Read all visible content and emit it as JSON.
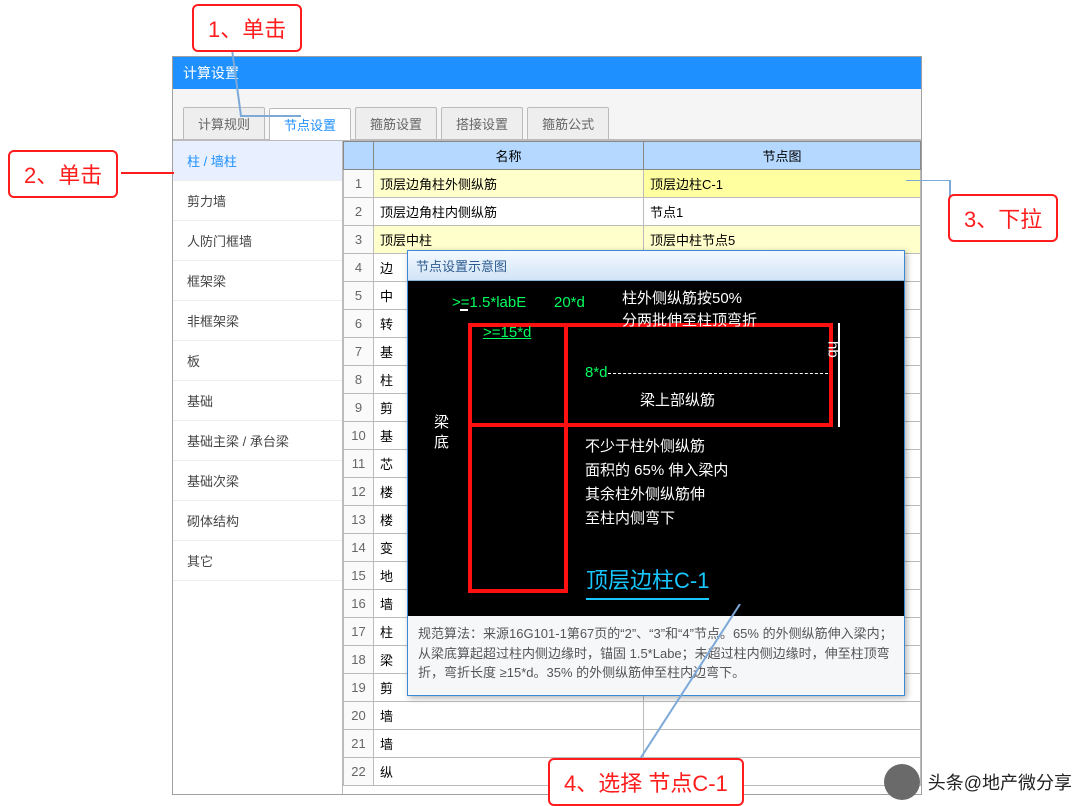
{
  "callouts": {
    "c1": "1、单击",
    "c2": "2、单击",
    "c3": "3、下拉",
    "c4": "4、选择 节点C-1"
  },
  "window": {
    "title": "计算设置"
  },
  "tabs": [
    "计算规则",
    "节点设置",
    "箍筋设置",
    "搭接设置",
    "箍筋公式"
  ],
  "active_tab": 1,
  "sidebar": [
    "柱 / 墙柱",
    "剪力墙",
    "人防门框墙",
    "框架梁",
    "非框架梁",
    "板",
    "基础",
    "基础主梁 / 承台梁",
    "基础次梁",
    "砌体结构",
    "其它"
  ],
  "active_side": 0,
  "columns": {
    "name": "名称",
    "node": "节点图"
  },
  "rows": [
    {
      "n": 1,
      "name": "顶层边角柱外侧纵筋",
      "node": "顶层边柱C-1",
      "hl": true,
      "sel": true
    },
    {
      "n": 2,
      "name": "顶层边角柱内侧纵筋",
      "node": "节点1"
    },
    {
      "n": 3,
      "name": "顶层中柱",
      "node": "顶层中柱节点5",
      "hl": true
    },
    {
      "n": 4,
      "name": "边",
      "node": ""
    },
    {
      "n": 5,
      "name": "中",
      "node": ""
    },
    {
      "n": 6,
      "name": "转",
      "node": ""
    },
    {
      "n": 7,
      "name": "基",
      "node": ""
    },
    {
      "n": 8,
      "name": "柱",
      "node": ""
    },
    {
      "n": 9,
      "name": "剪",
      "node": ""
    },
    {
      "n": 10,
      "name": "基",
      "node": ""
    },
    {
      "n": 11,
      "name": "芯",
      "node": ""
    },
    {
      "n": 12,
      "name": "楼",
      "node": ""
    },
    {
      "n": 13,
      "name": "楼",
      "node": ""
    },
    {
      "n": 14,
      "name": "变",
      "node": ""
    },
    {
      "n": 15,
      "name": "地",
      "node": ""
    },
    {
      "n": 16,
      "name": "墙",
      "node": ""
    },
    {
      "n": 17,
      "name": "柱",
      "node": ""
    },
    {
      "n": 18,
      "name": "梁",
      "node": ""
    },
    {
      "n": 19,
      "name": "剪",
      "node": ""
    },
    {
      "n": 20,
      "name": "墙",
      "node": ""
    },
    {
      "n": 21,
      "name": "墙",
      "node": ""
    },
    {
      "n": 22,
      "name": "纵",
      "node": ""
    }
  ],
  "popup": {
    "title": "节点设置示意图",
    "g1": ">=1.5*labE",
    "g2": "20*d",
    "g3": ">=15*d",
    "g4": "8*d",
    "t1a": "柱外侧纵筋按50%",
    "t1b": "分两批伸至柱顶弯折",
    "t2": "梁上部纵筋",
    "hb": "hb",
    "lb": "梁底",
    "t3a": "不少于柱外侧纵筋",
    "t3b": "面积的 65% 伸入梁内",
    "t3c": "其余柱外侧纵筋伸",
    "t3d": "至柱内侧弯下",
    "name": "顶层边柱C-1",
    "note": "规范算法：来源16G101-1第67页的“2”、“3”和“4”节点。65% 的外侧纵筋伸入梁内；从梁底算起超过柱内侧边缘时，锚固 1.5*Labe；未超过柱内侧边缘时，伸至柱顶弯折，弯折长度 ≥15*d。35% 的外侧纵筋伸至柱内边弯下。"
  },
  "footer": "头条@地产微分享"
}
